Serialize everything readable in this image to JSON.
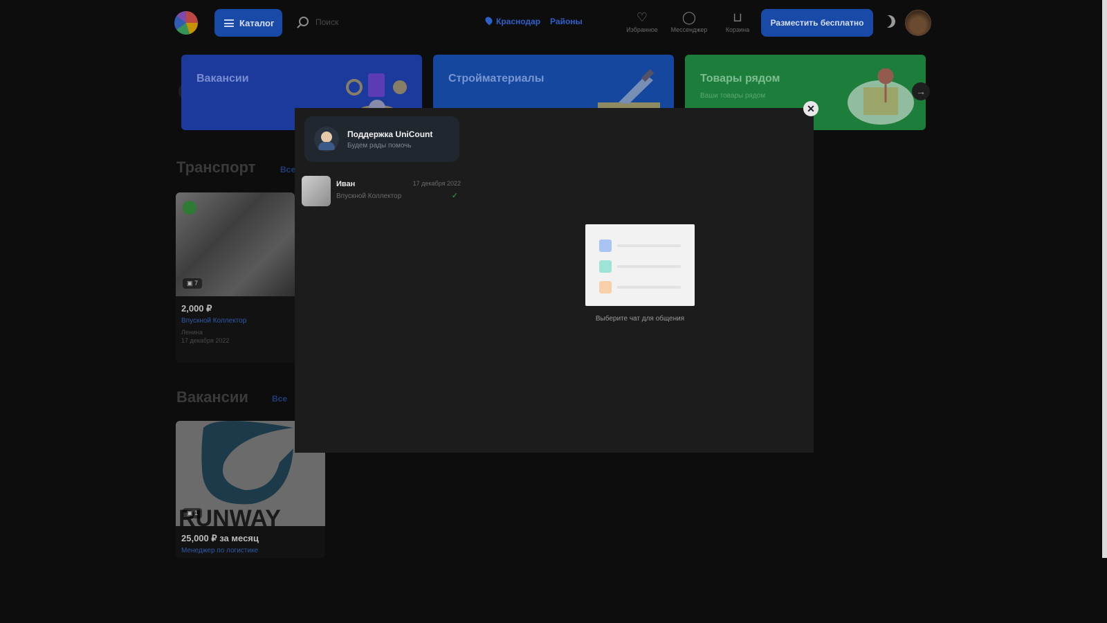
{
  "header": {
    "catalog_label": "Каталог",
    "search_placeholder": "Поиск",
    "city": "Краснодар",
    "districts": "Районы",
    "favorites": "Избранное",
    "messenger": "Мессенджер",
    "cart": "Корзина",
    "post_button": "Разместить бесплатно"
  },
  "banners": [
    {
      "title": "Вакансии",
      "subtitle": "",
      "color": "#1c3a9c"
    },
    {
      "title": "Стройматериалы",
      "subtitle": "",
      "color": "#16479e"
    },
    {
      "title": "Товары рядом",
      "subtitle": "Ваши товары рядом",
      "color": "#1d7d3a"
    }
  ],
  "sections": {
    "transport_title": "Транспорт",
    "transport_link": "Все",
    "vacancies_title": "Вакансии",
    "vacancies_link": "Все"
  },
  "transport_card": {
    "photo_count": "7",
    "price": "2,000 ₽",
    "name": "Впускной Коллектор",
    "location": "Ленина",
    "date": "17 декабря 2022"
  },
  "vacancy_card": {
    "photo_count": "1",
    "price": "25,000 ₽ за месяц",
    "name": "Менеджер по логистике"
  },
  "chat": {
    "support_name": "Поддержка UniCount",
    "support_sub": "Будем рады помочь",
    "items": [
      {
        "name": "Иван",
        "date": "17 декабря 2022",
        "preview": "Впускной Коллектор",
        "read": "✓"
      }
    ],
    "empty_text": "Выберите чат для общения"
  },
  "colors": {
    "accent": "#1a4aa8",
    "modal_bg": "#1c1c1c",
    "page_bg": "#0d0d0e"
  }
}
